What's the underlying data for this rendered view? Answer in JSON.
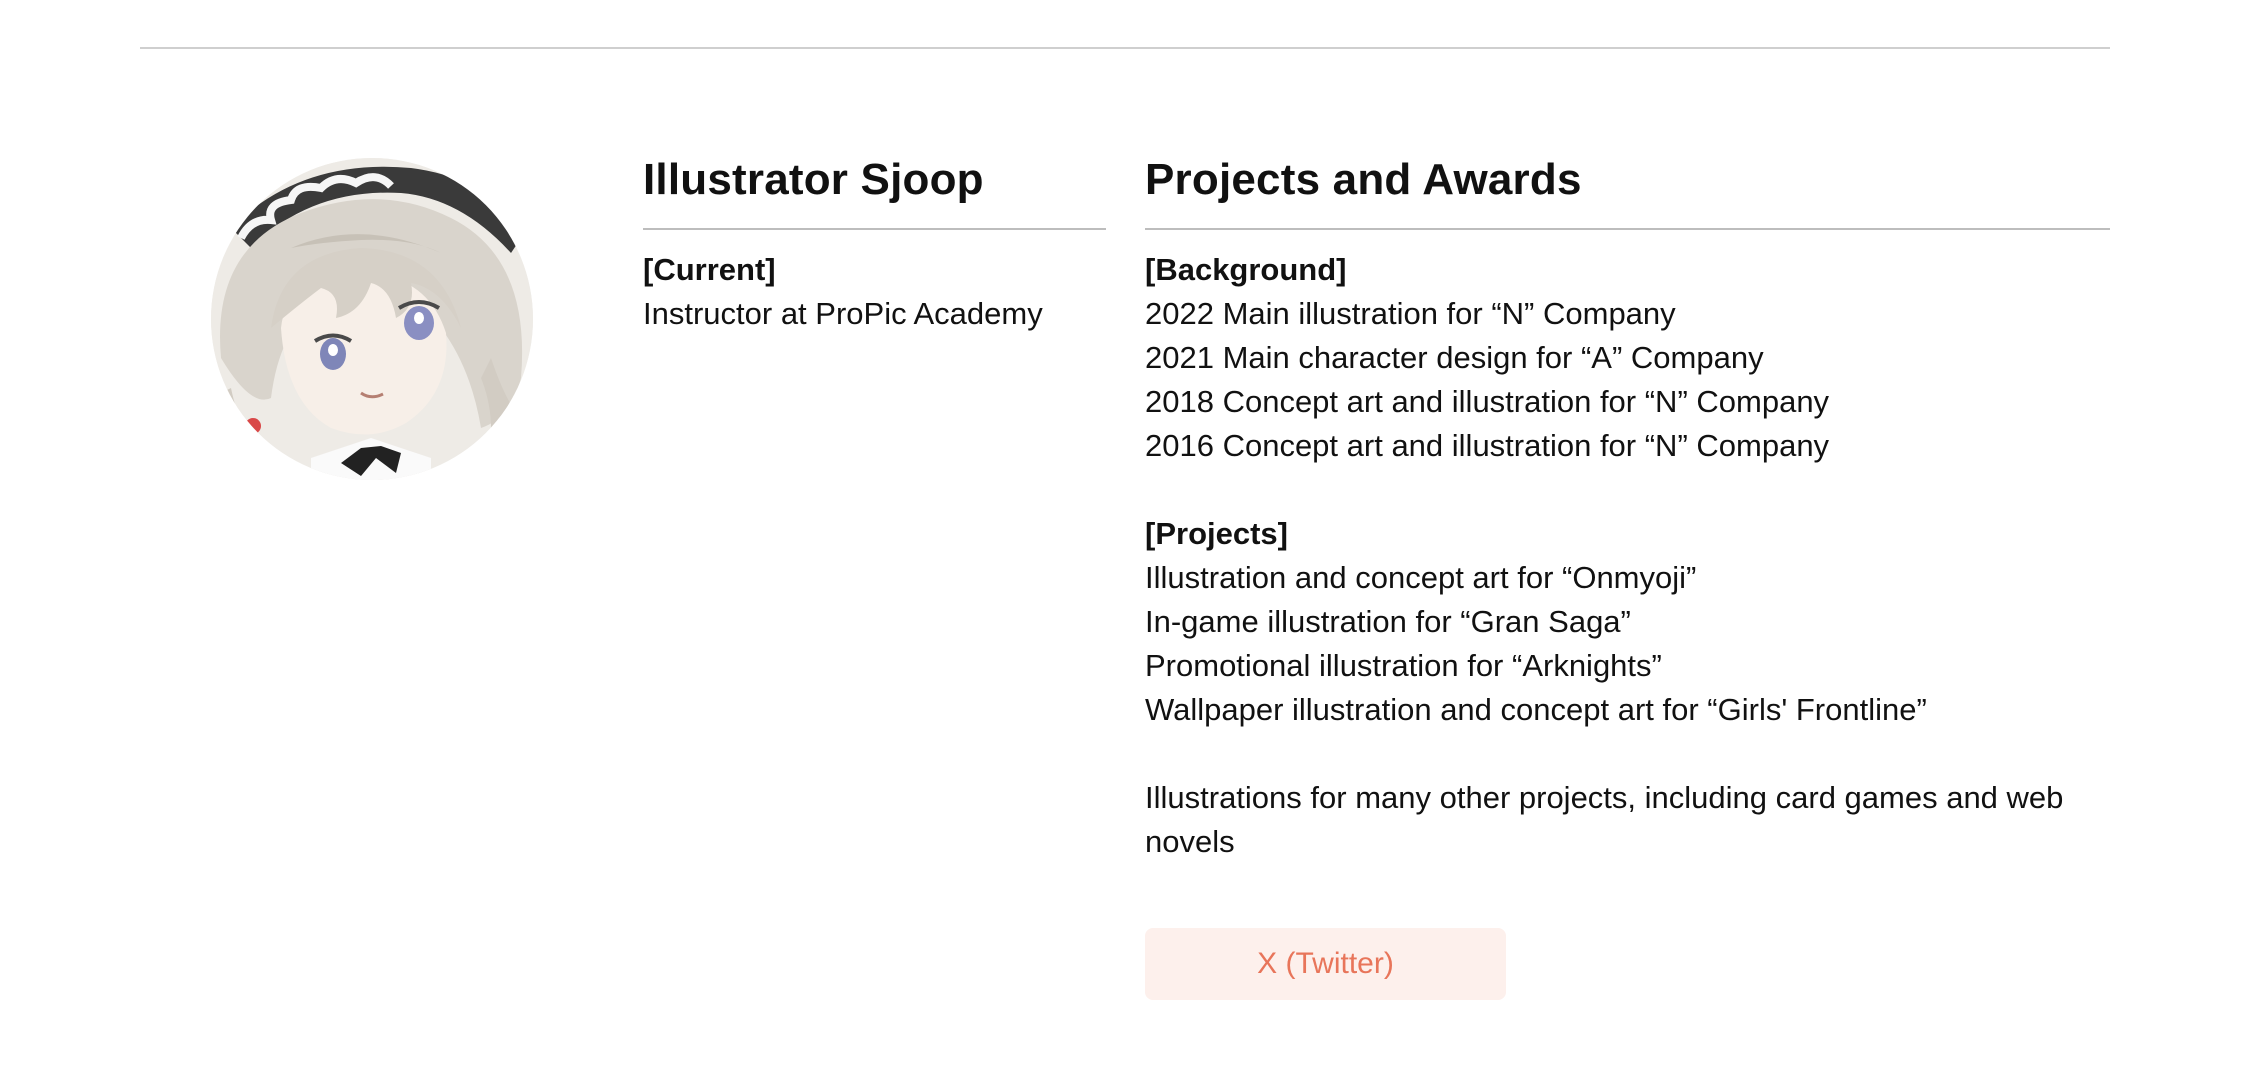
{
  "profile": {
    "name": "Illustrator Sjoop",
    "current_label": "[Current]",
    "current_role": "Instructor at ProPic Academy"
  },
  "awards": {
    "title": "Projects and Awards",
    "background_label": "[Background]",
    "background_items": [
      "2022 Main illustration for “N” Company",
      "2021 Main character design for “A” Company",
      "2018 Concept art and illustration for “N” Company",
      "2016 Concept art and illustration for “N” Company"
    ],
    "projects_label": "[Projects]",
    "project_items": [
      "Illustration and concept art for “Onmyoji”",
      "In-game illustration for “Gran Saga”",
      "Promotional illustration for “Arknights”",
      "Wallpaper illustration and concept art for “Girls' Frontline”"
    ],
    "other_note": "Illustrations for many other projects, including card games and web novels"
  },
  "social": {
    "x_label": "X (Twitter)"
  },
  "colors": {
    "button_bg": "#fdf0ec",
    "button_text": "#e8755a",
    "rule": "#bdbdbd"
  }
}
